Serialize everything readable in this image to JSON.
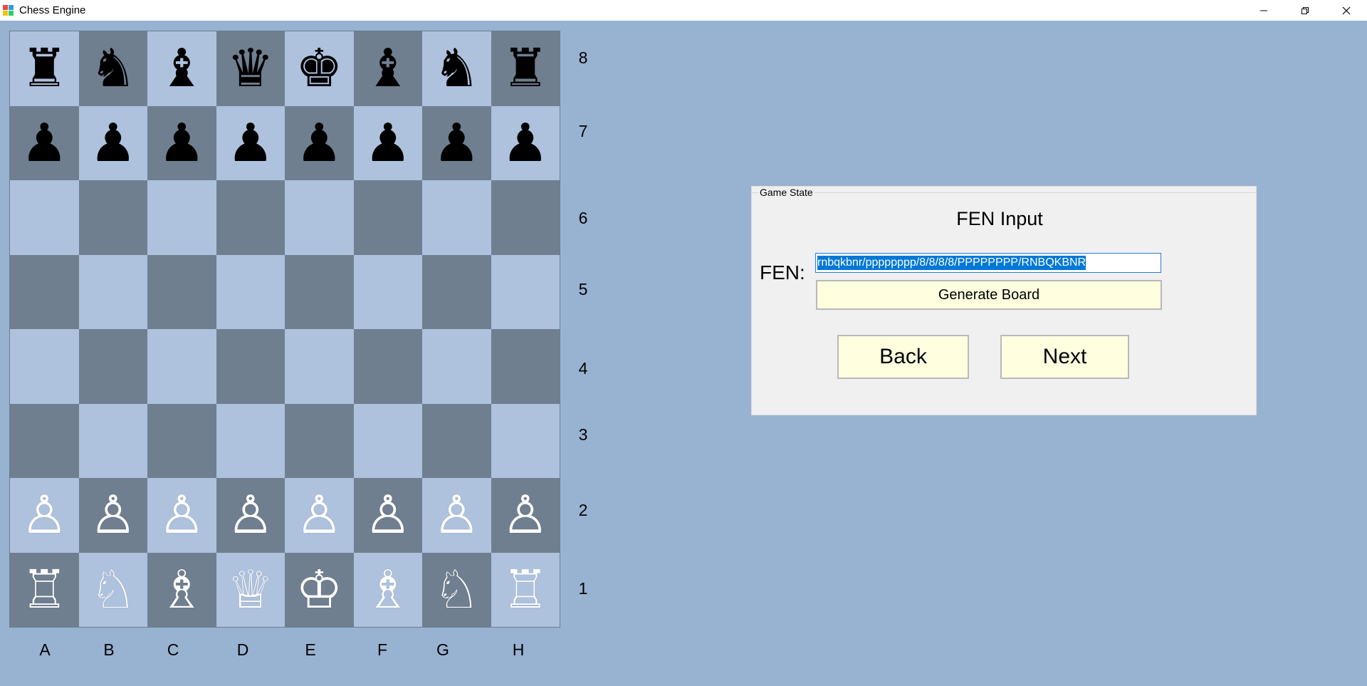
{
  "window": {
    "title": "Chess Engine",
    "controls": [
      "minimize-icon",
      "restore-icon",
      "close-icon"
    ]
  },
  "colors": {
    "background": "#98b2d1",
    "light_square": "#aec2de",
    "dark_square": "#6f7f90",
    "button_fill": "#ffffe0",
    "selection": "#0078d7"
  },
  "board": {
    "rows": [
      [
        "♜",
        "♞",
        "♝",
        "♛",
        "♚",
        "♝",
        "♞",
        "♜"
      ],
      [
        "♟",
        "♟",
        "♟",
        "♟",
        "♟",
        "♟",
        "♟",
        "♟"
      ],
      [
        "",
        "",
        "",
        "",
        "",
        "",
        "",
        ""
      ],
      [
        "",
        "",
        "",
        "",
        "",
        "",
        "",
        ""
      ],
      [
        "",
        "",
        "",
        "",
        "",
        "",
        "",
        ""
      ],
      [
        "",
        "",
        "",
        "",
        "",
        "",
        "",
        ""
      ],
      [
        "♙",
        "♙",
        "♙",
        "♙",
        "♙",
        "♙",
        "♙",
        "♙"
      ],
      [
        "♖",
        "♘",
        "♗",
        "♕",
        "♔",
        "♗",
        "♘",
        "♖"
      ]
    ],
    "row_colors": [
      "black",
      "black",
      "",
      "",
      "",
      "",
      "white",
      "white"
    ],
    "ranks": [
      "8",
      "7",
      "6",
      "5",
      "4",
      "3",
      "2",
      "1"
    ],
    "files": [
      "A",
      "B",
      "C",
      "D",
      "E",
      "F",
      "G",
      "H"
    ]
  },
  "game_state": {
    "group_title": "Game State",
    "heading": "FEN Input",
    "fen_label": "FEN:",
    "fen_value": "rnbqkbnr/pppppppp/8/8/8/8/PPPPPPPP/RNBQKBNR",
    "generate_label": "Generate Board",
    "back_label": "Back",
    "next_label": "Next"
  }
}
